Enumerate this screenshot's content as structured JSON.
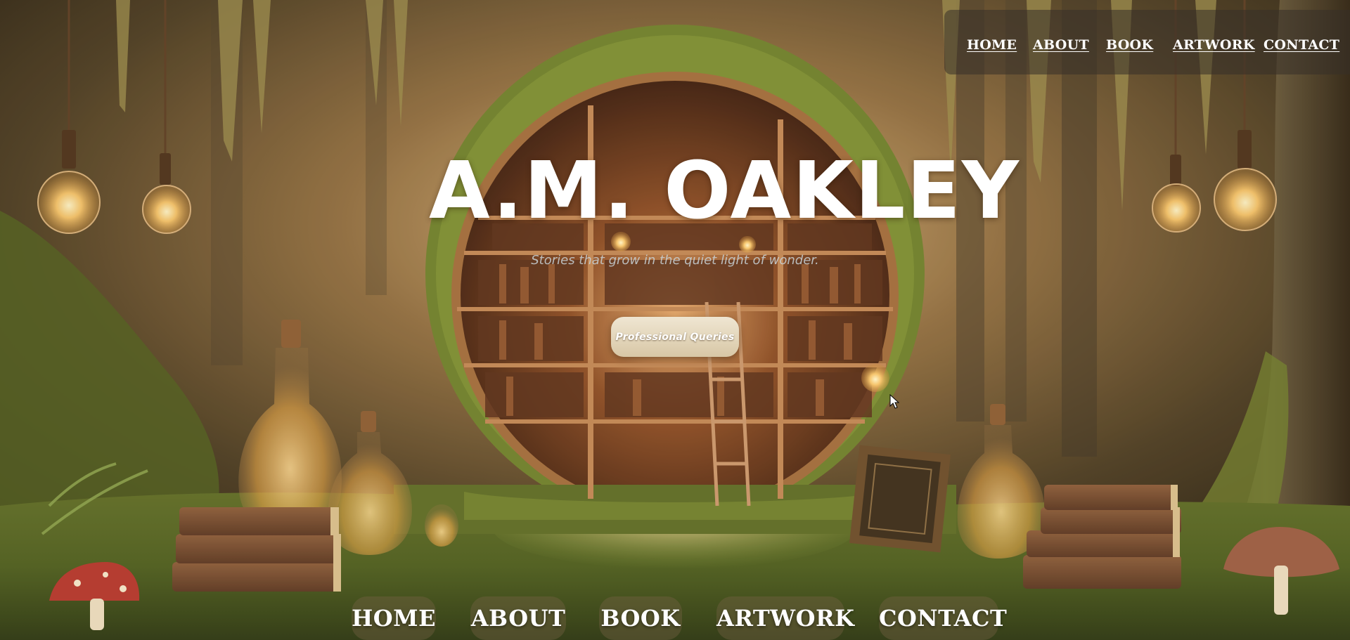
{
  "nav": {
    "items": [
      {
        "label": "HOME"
      },
      {
        "label": "ABOUT"
      },
      {
        "label": "BOOK"
      },
      {
        "label": "ARTWORK"
      },
      {
        "label": "CONTACT"
      }
    ]
  },
  "hero": {
    "title": "A.M. OAKLEY",
    "tagline": "Stories that grow in the quiet light of wonder.",
    "cta_label": "Professional Queries"
  },
  "footer_nav": {
    "items": [
      {
        "label": "HOME"
      },
      {
        "label": "ABOUT"
      },
      {
        "label": "BOOK"
      },
      {
        "label": "ARTWORK"
      },
      {
        "label": "CONTACT"
      }
    ]
  },
  "colors": {
    "text": "#ffffff",
    "button": "#e2d5b9",
    "nav_bar": "#373028"
  }
}
